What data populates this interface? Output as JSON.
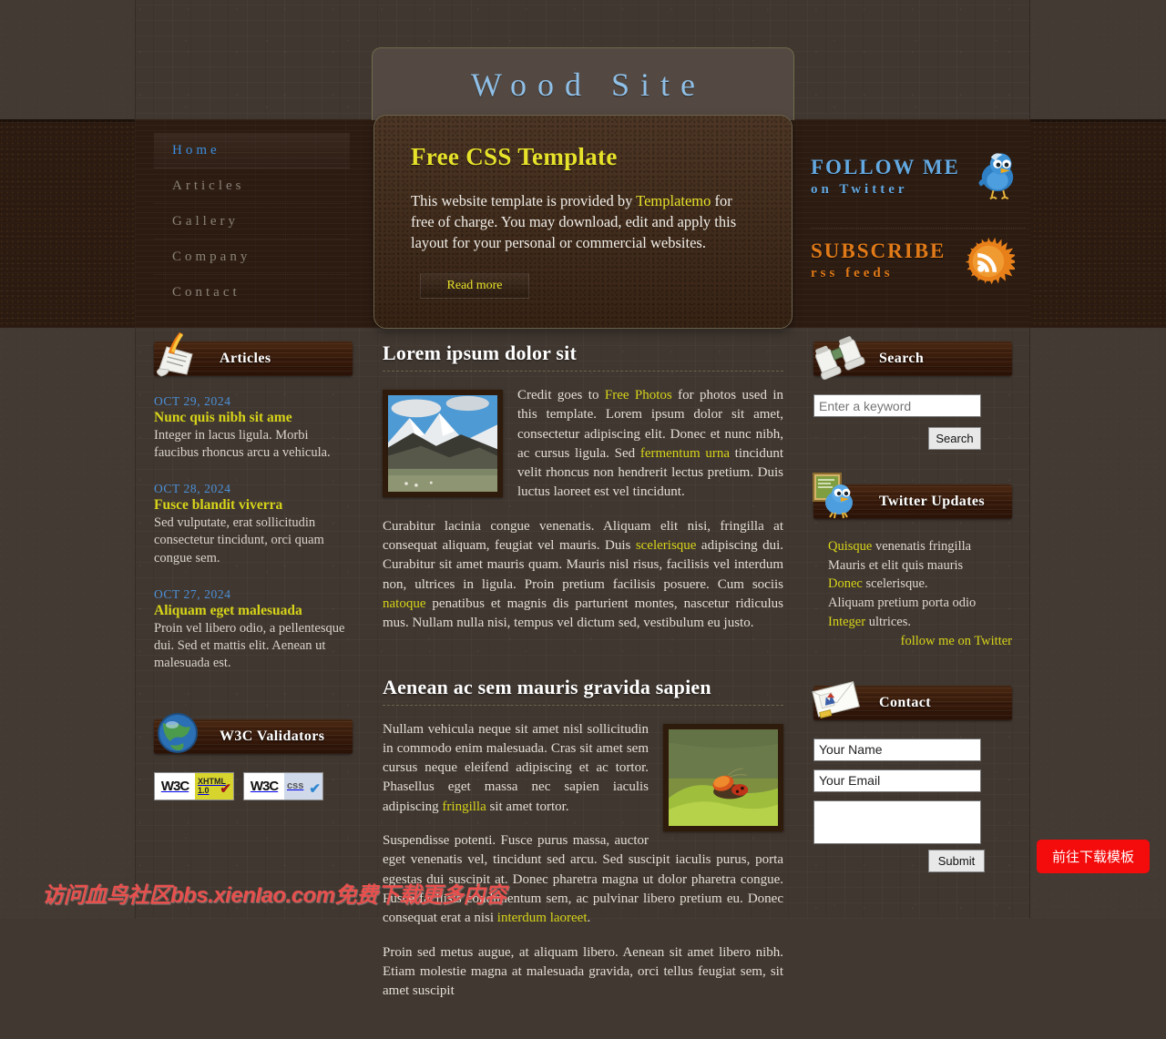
{
  "site": {
    "title": "Wood Site"
  },
  "nav": {
    "items": [
      {
        "label": "Home",
        "active": true
      },
      {
        "label": "Articles",
        "active": false
      },
      {
        "label": "Gallery",
        "active": false
      },
      {
        "label": "Company",
        "active": false
      },
      {
        "label": "Contact",
        "active": false
      }
    ]
  },
  "feature": {
    "heading": "Free CSS Template",
    "text_before": "This website template is provided by ",
    "link": "Templatemo",
    "text_after": " for free of charge. You may download, edit and apply this layout for your personal or commercial websites.",
    "button": "Read more"
  },
  "banner_right": {
    "follow": {
      "line1": "FOLLOW ME",
      "line2": "on Twitter",
      "icon": "twitter-bird-icon"
    },
    "subscribe": {
      "line1": "SUBSCRIBE",
      "line2": "rss feeds",
      "icon": "rss-feed-icon"
    }
  },
  "left_sidebar": {
    "articles": {
      "heading": "Articles",
      "icon": "quill-scroll-icon",
      "items": [
        {
          "date": "OCT 29, 2024",
          "title": "Nunc quis nibh sit ame",
          "text": "Integer in lacus ligula. Morbi faucibus rhoncus arcu a vehicula."
        },
        {
          "date": "OCT 28, 2024",
          "title": "Fusce blandit viverra",
          "text": "Sed vulputate, erat sollicitudin consectetur tincidunt, orci quam congue sem."
        },
        {
          "date": "OCT 27, 2024",
          "title": "Aliquam eget malesuada",
          "text": "Proin vel libero odio, a pellentesque dui. Sed et mattis elit. Aenean ut malesuada est."
        }
      ]
    },
    "validators": {
      "heading": "W3C Validators",
      "icon": "globe-icon",
      "badges": [
        {
          "mark": "W3C",
          "label_line1": "XHTML",
          "label_line2": "1.0",
          "tick": "✔"
        },
        {
          "mark": "W3C",
          "label_line1": "css",
          "label_line2": "",
          "tick": "✔"
        }
      ]
    }
  },
  "main": {
    "posts": [
      {
        "heading": "Lorem ipsum dolor sit",
        "image": "mountain-landscape-photo",
        "p1_a": "Credit goes to ",
        "p1_link1": "Free Photos",
        "p1_b": " for photos used in this template. Lorem ipsum dolor sit amet, consectetur adipiscing elit. Donec et nunc nibh, ac cursus ligula. Sed ",
        "p1_link2": "fermentum urna",
        "p1_c": " tincidunt velit rhoncus non hendrerit lectus pretium. Duis luctus laoreet est vel tincidunt.",
        "p2_a": "Curabitur lacinia congue venenatis. Aliquam elit nisi, fringilla at consequat aliquam, feugiat vel mauris. Duis ",
        "p2_link1": "scelerisque",
        "p2_b": " adipiscing dui. Curabitur sit amet mauris quam. Mauris nisl risus, facilisis vel interdum non, ultrices in ligula. Proin pretium facilisis posuere. Cum sociis ",
        "p2_link2": "natoque",
        "p2_c": " penatibus et magnis dis parturient montes, nascetur ridiculus mus. Nullam nulla nisi, tempus vel dictum sed, vestibulum eu justo."
      },
      {
        "heading": "Aenean ac sem mauris gravida sapien",
        "image": "beetle-on-leaf-photo",
        "p1_a": "Nullam vehicula neque sit amet nisl sollicitudin in commodo enim malesuada. Cras sit amet sem cursus neque eleifend adipiscing et ac tortor. Phasellus eget massa nec sapien iaculis adipiscing ",
        "p1_link1": "fringilla",
        "p1_b": " sit amet tortor.",
        "p2_a": "Suspendisse potenti. Fusce purus massa, auctor eget venenatis vel, tincidunt sed arcu. Sed suscipit iaculis purus, porta egestas dui suscipit at. Donec pharetra magna ut dolor pharetra congue. Fusce facilisis condimentum sem, ac pulvinar libero pretium eu. Donec consequat erat a nisi ",
        "p2_link1": "interdum laoreet",
        "p2_b": ".",
        "p3": "Proin sed metus augue, at aliquam libero. Aenean sit amet libero nibh. Etiam molestie magna at malesuada gravida, orci tellus feugiat sem, sit amet suscipit"
      }
    ]
  },
  "right_sidebar": {
    "search": {
      "heading": "Search",
      "icon": "binoculars-icon",
      "placeholder": "Enter a keyword",
      "value": "",
      "button": "Search"
    },
    "twitter": {
      "heading": "Twitter Updates",
      "icon": "twitter-bird-board-icon",
      "updates": [
        {
          "link": "Quisque",
          "rest": " venenatis fringilla"
        },
        {
          "link": "",
          "rest": "Mauris et elit quis mauris"
        },
        {
          "link": "Donec",
          "rest": " scelerisque."
        },
        {
          "link": "",
          "rest": "Aliquam pretium porta odio"
        },
        {
          "link": "Integer",
          "rest": " ultrices."
        }
      ],
      "follow_link": "follow me on Twitter"
    },
    "contact": {
      "heading": "Contact",
      "icon": "envelope-icon",
      "name_placeholder": "Your Name",
      "name_value": "Your Name",
      "email_placeholder": "Your Email",
      "email_value": "Your Email",
      "message_value": "",
      "submit": "Submit"
    }
  },
  "overlay": {
    "watermark": "访问血鸟社区bbs.xienIao.com免费下载更多内容",
    "download_button": "前往下载模板"
  },
  "colors": {
    "accent_yellow": "#d7d419",
    "accent_blue": "#63a8e0",
    "accent_orange": "#e07a18",
    "wood_dark": "#2a1a10",
    "page_bg": "#433a33",
    "red_button": "#f40c0c"
  }
}
